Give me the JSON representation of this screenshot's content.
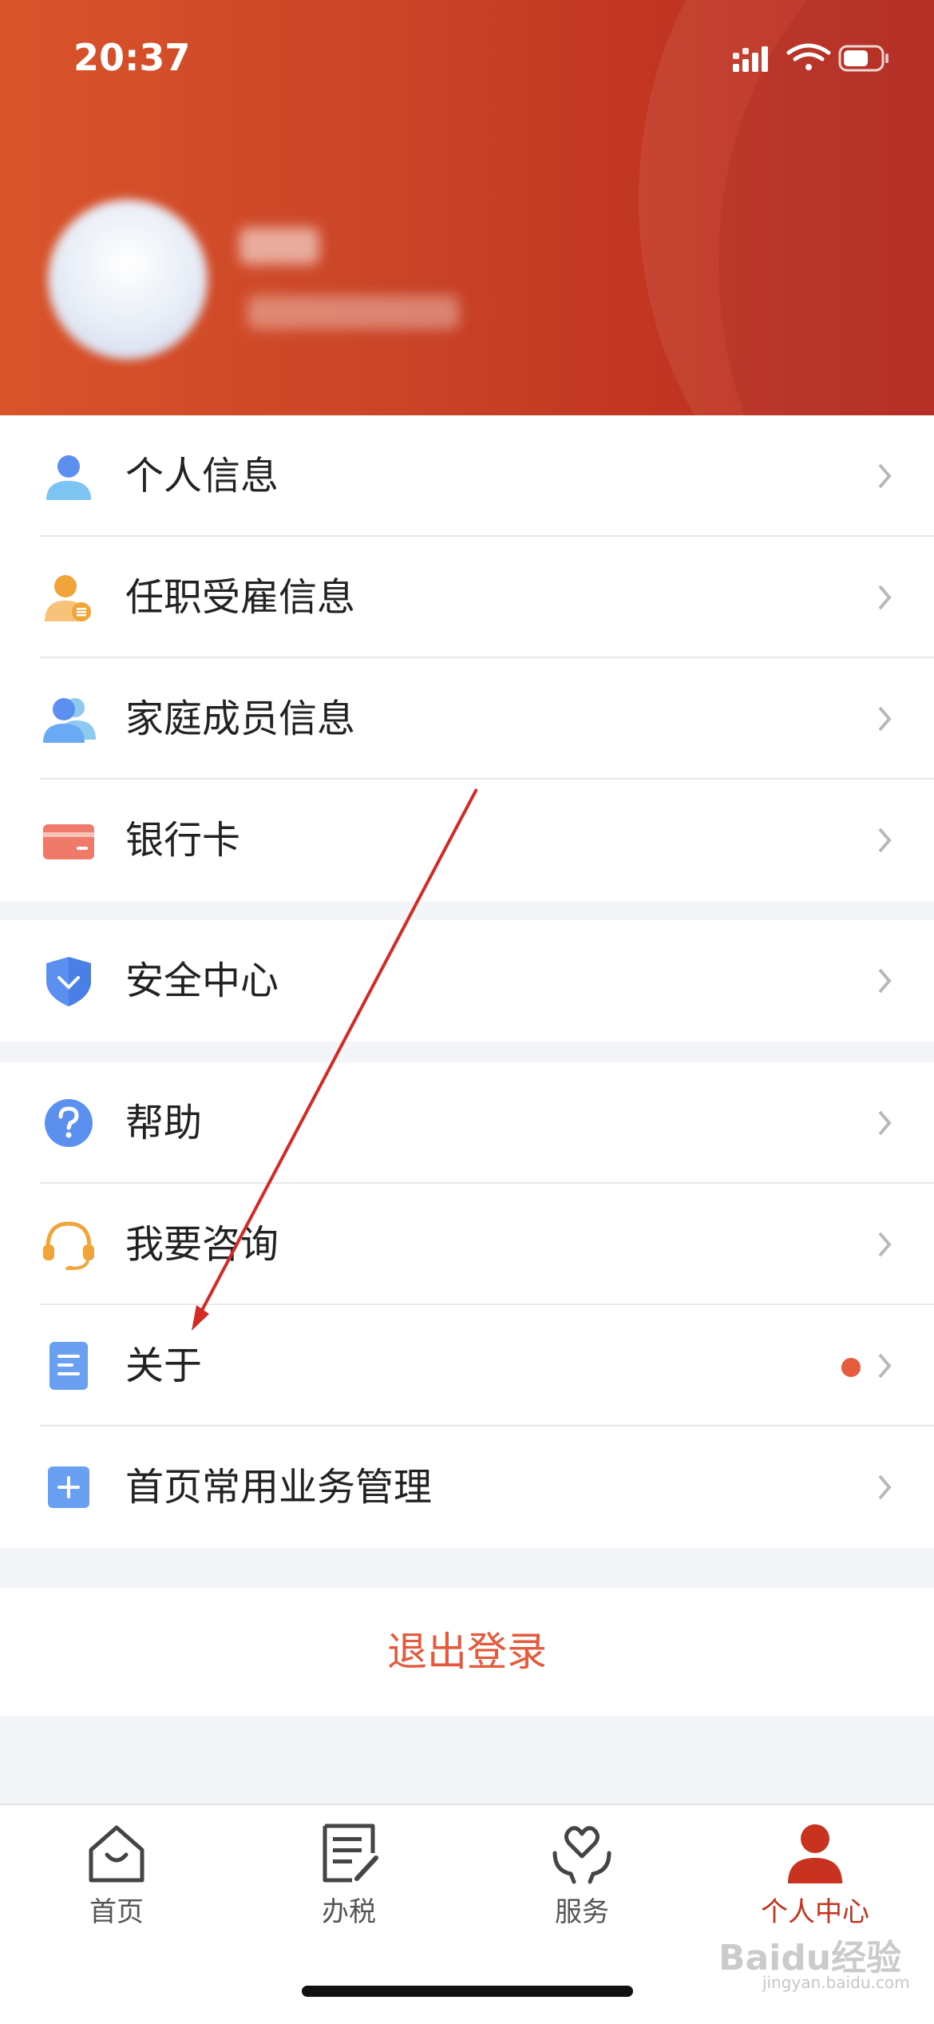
{
  "status_bar": {
    "time": "20:37"
  },
  "profile": {
    "name": "",
    "id_masked": ""
  },
  "menu_group_1": [
    {
      "label": "个人信息",
      "icon": "person-icon"
    },
    {
      "label": "任职受雇信息",
      "icon": "employment-icon"
    },
    {
      "label": "家庭成员信息",
      "icon": "family-icon"
    },
    {
      "label": "银行卡",
      "icon": "bank-card-icon"
    }
  ],
  "menu_group_2": [
    {
      "label": "安全中心",
      "icon": "shield-icon"
    }
  ],
  "menu_group_3": [
    {
      "label": "帮助",
      "icon": "question-icon"
    },
    {
      "label": "我要咨询",
      "icon": "headset-icon"
    },
    {
      "label": "关于",
      "icon": "document-icon",
      "has_badge": true
    },
    {
      "label": "首页常用业务管理",
      "icon": "plus-icon"
    }
  ],
  "logout_label": "退出登录",
  "tabbar": [
    {
      "label": "首页",
      "icon": "home-icon",
      "active": false
    },
    {
      "label": "办税",
      "icon": "tax-icon",
      "active": false
    },
    {
      "label": "服务",
      "icon": "heart-hands-icon",
      "active": false
    },
    {
      "label": "个人中心",
      "icon": "user-icon",
      "active": true
    }
  ],
  "colors": {
    "header_start": "#d9542a",
    "header_end": "#b8261c",
    "accent": "#c8321f",
    "badge": "#e55b3e"
  },
  "watermark": {
    "brand": "Baidu经验",
    "site": "jingyan.baidu.com"
  }
}
